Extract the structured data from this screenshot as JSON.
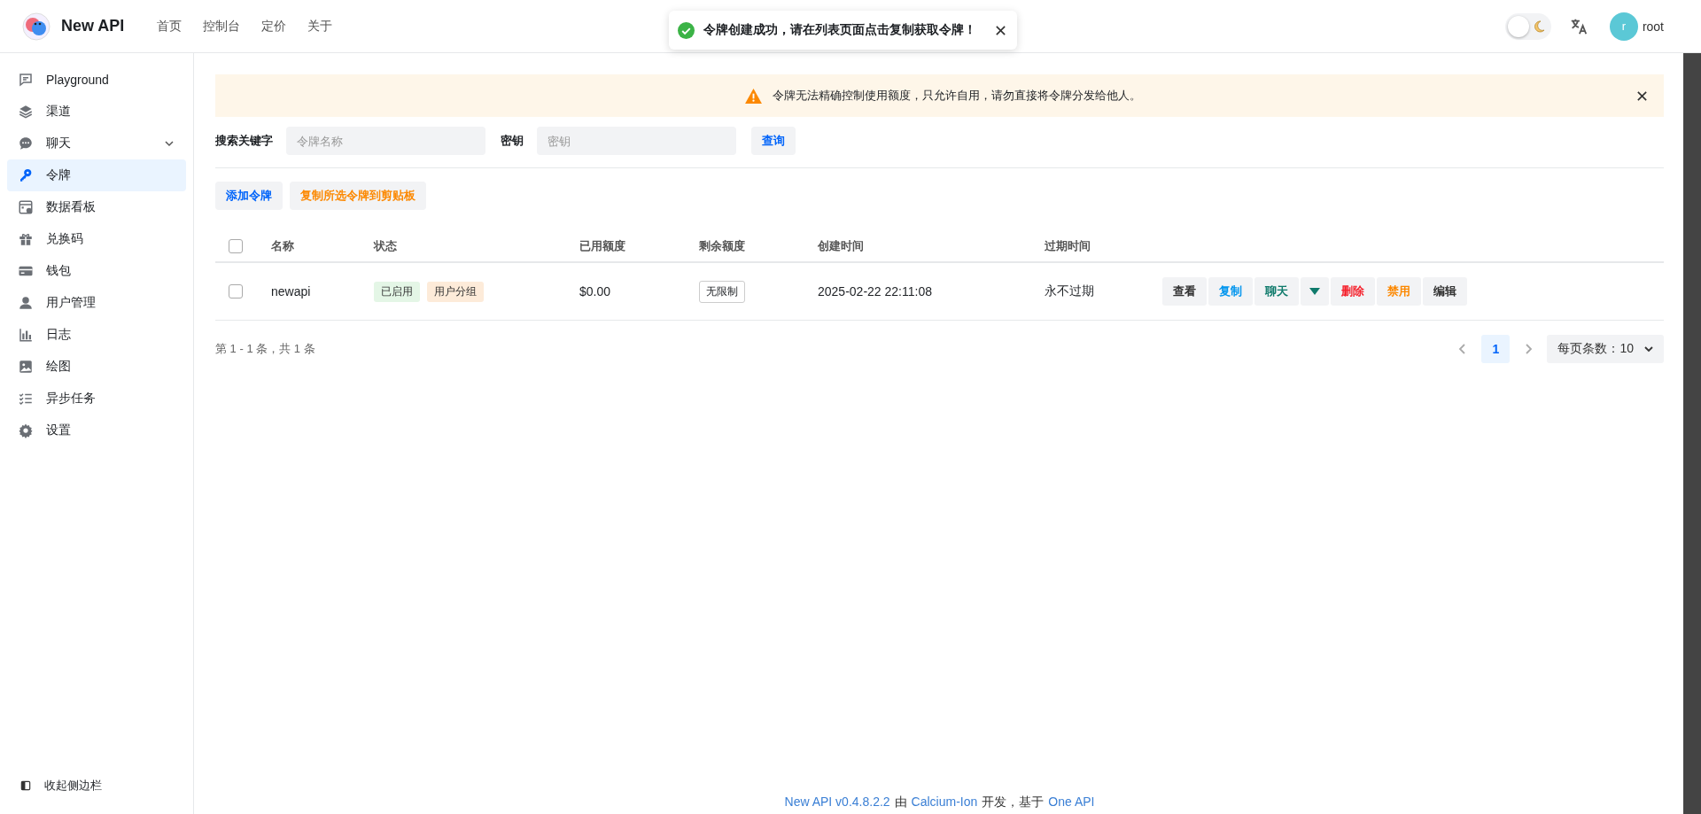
{
  "header": {
    "brand": "New API",
    "nav": [
      {
        "label": "首页"
      },
      {
        "label": "控制台"
      },
      {
        "label": "定价"
      },
      {
        "label": "关于"
      }
    ],
    "dark_mode": false,
    "user": {
      "initial": "r",
      "name": "root"
    }
  },
  "toast": {
    "message": "令牌创建成功，请在列表页面点击复制获取令牌！"
  },
  "sidebar": {
    "items": [
      {
        "label": "Playground",
        "selected": false
      },
      {
        "label": "渠道",
        "selected": false
      },
      {
        "label": "聊天",
        "selected": false,
        "expanded": false
      },
      {
        "label": "令牌",
        "selected": true
      },
      {
        "label": "数据看板",
        "selected": false
      },
      {
        "label": "兑换码",
        "selected": false
      },
      {
        "label": "钱包",
        "selected": false
      },
      {
        "label": "用户管理",
        "selected": false
      },
      {
        "label": "日志",
        "selected": false
      },
      {
        "label": "绘图",
        "selected": false
      },
      {
        "label": "异步任务",
        "selected": false
      },
      {
        "label": "设置",
        "selected": false
      }
    ],
    "collapse": "收起侧边栏"
  },
  "alert": {
    "message": "令牌无法精确控制使用额度，只允许自用，请勿直接将令牌分发给他人。"
  },
  "search": {
    "keyword_label": "搜索关键字",
    "keyword_placeholder": "令牌名称",
    "key_label": "密钥",
    "key_placeholder": "密钥",
    "button": "查询"
  },
  "toolbar": [
    {
      "label": "添加令牌",
      "kind": "primary"
    },
    {
      "label": "复制所选令牌到剪贴板",
      "kind": "warning"
    }
  ],
  "table": {
    "columns": [
      "名称",
      "状态",
      "已用额度",
      "剩余额度",
      "创建时间",
      "过期时间"
    ],
    "all_checked": false,
    "rows": [
      {
        "checked": false,
        "name": "newapi",
        "tags": [
          {
            "label": "已启用",
            "color": "#e4f6e6"
          },
          {
            "label": "用户分组",
            "color": "#fdebd9"
          }
        ],
        "used": "$0.00",
        "remaining": "无限制",
        "created": "2025-02-22 22:11:08",
        "expires": "永不过期",
        "actions": [
          {
            "label": "查看",
            "kind": "neutral"
          },
          {
            "label": "复制",
            "kind": "primary"
          },
          {
            "label": "聊天",
            "kind": "teal"
          },
          {
            "kind": "dropdown"
          },
          {
            "label": "删除",
            "kind": "danger"
          },
          {
            "label": "禁用",
            "kind": "warning"
          },
          {
            "label": "编辑",
            "kind": "neutral"
          }
        ]
      }
    ]
  },
  "pagination": {
    "summary": "第 1 - 1 条，共 1 条",
    "pages": [
      {
        "label": "1",
        "selected": true
      }
    ],
    "page_size": "每页条数：10"
  },
  "footer": {
    "parts": [
      {
        "text": "New API v0.4.8.2.2",
        "link": true
      },
      {
        "text": "由",
        "link": false
      },
      {
        "text": "Calcium-Ion",
        "link": true
      },
      {
        "text": "开发，基于",
        "link": false
      },
      {
        "text": "One API",
        "link": true
      }
    ]
  }
}
